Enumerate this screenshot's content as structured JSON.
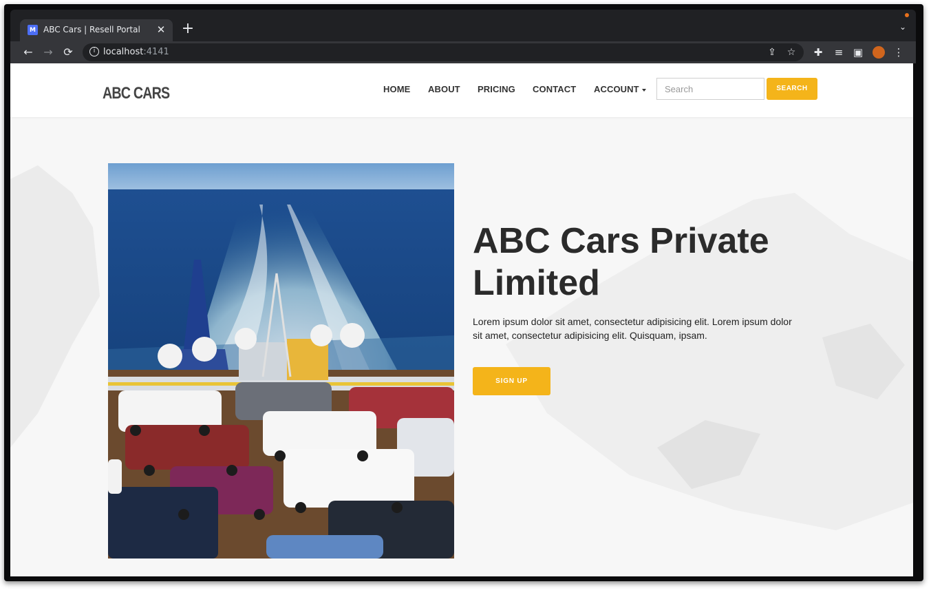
{
  "browser": {
    "tab_title": "ABC Cars | Resell Portal",
    "favicon_text": "M",
    "url_host": "localhost",
    "url_port": ":4141",
    "tab_close_glyph": "✕",
    "new_tab_glyph": "+",
    "icons": [
      "back-icon",
      "forward-icon",
      "reload-icon",
      "info-icon",
      "share-icon",
      "star-icon",
      "extensions-icon",
      "media-icon",
      "side-panel-icon",
      "profile-icon",
      "menu-icon",
      "tab-search-icon"
    ]
  },
  "site": {
    "logo": "ABC CARS",
    "nav": {
      "home": "HOME",
      "about": "ABOUT",
      "pricing": "PRICING",
      "contact": "CONTACT",
      "account": "ACCOUNT"
    },
    "search": {
      "placeholder": "Search",
      "button_label": "SEARCH"
    },
    "accent_color": "#f4b41a"
  },
  "hero": {
    "title": "ABC Cars Private Limited",
    "text": "Lorem ipsum dolor sit amet, consectetur adipisicing elit. Lorem ipsum dolor sit amet, consectetur adipisicing elit. Quisquam, ipsam.",
    "signup_label": "SIGN UP",
    "image_subject": "ferry deck loaded with cars, sea and wake behind"
  }
}
